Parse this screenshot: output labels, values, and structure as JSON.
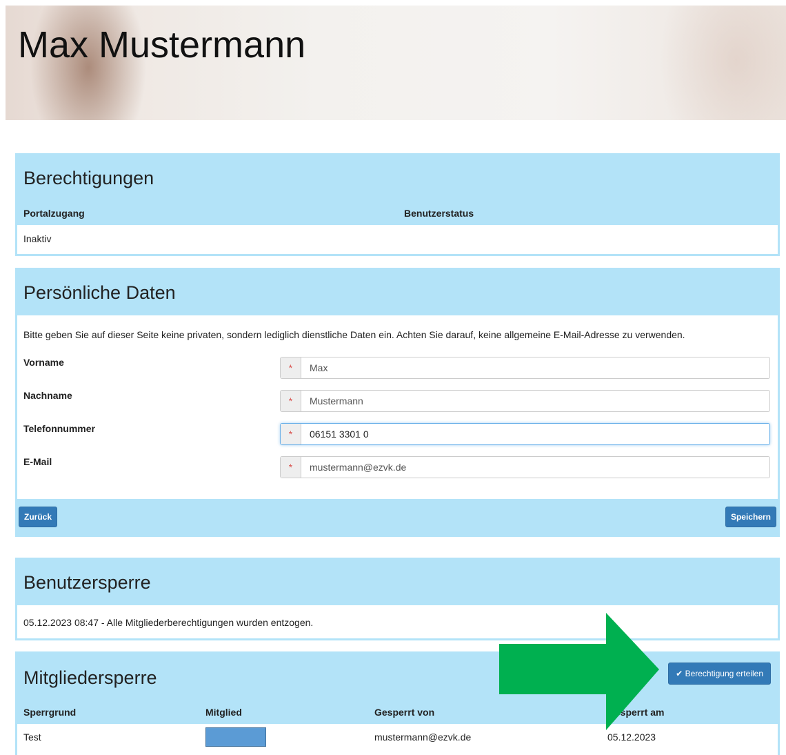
{
  "header": {
    "title": "Max Mustermann"
  },
  "berechtigungen": {
    "title": "Berechtigungen",
    "columns": [
      "Portalzugang",
      "Benutzerstatus"
    ],
    "rows": [
      [
        "Inaktiv",
        ""
      ]
    ]
  },
  "persoenliche_daten": {
    "title": "Persönliche Daten",
    "info": "Bitte geben Sie auf dieser Seite keine privaten, sondern lediglich dienstliche Daten ein. Achten Sie darauf, keine allgemeine E-Mail-Adresse zu verwenden.",
    "required_marker": "*",
    "fields": {
      "vorname": {
        "label": "Vorname",
        "value": "Max"
      },
      "nachname": {
        "label": "Nachname",
        "value": "Mustermann"
      },
      "telefon": {
        "label": "Telefonnummer",
        "value": "06151 3301 0"
      },
      "email": {
        "label": "E-Mail",
        "value": "mustermann@ezvk.de"
      }
    },
    "back_label": "Zurück",
    "save_label": "Speichern"
  },
  "benutzersperre": {
    "title": "Benutzersperre",
    "message": "05.12.2023 08:47 - Alle Mitgliederberechtigungen wurden entzogen."
  },
  "mitgliedersperre": {
    "title": "Mitgliedersperre",
    "grant_label": "Berechtigung erteilen",
    "grant_icon": "check-icon",
    "columns": [
      "Sperrgrund",
      "Mitglied",
      "Gesperrt von",
      "Gesperrt am"
    ],
    "rows": [
      {
        "sperrgrund": "Test",
        "gesperrt_von": "mustermann@ezvk.de",
        "gesperrt_am": "05.12.2023"
      }
    ]
  },
  "colors": {
    "panel": "#b3e3f8",
    "button": "#337ab7",
    "arrow": "#00b050",
    "redacted": "#5b9bd5"
  }
}
